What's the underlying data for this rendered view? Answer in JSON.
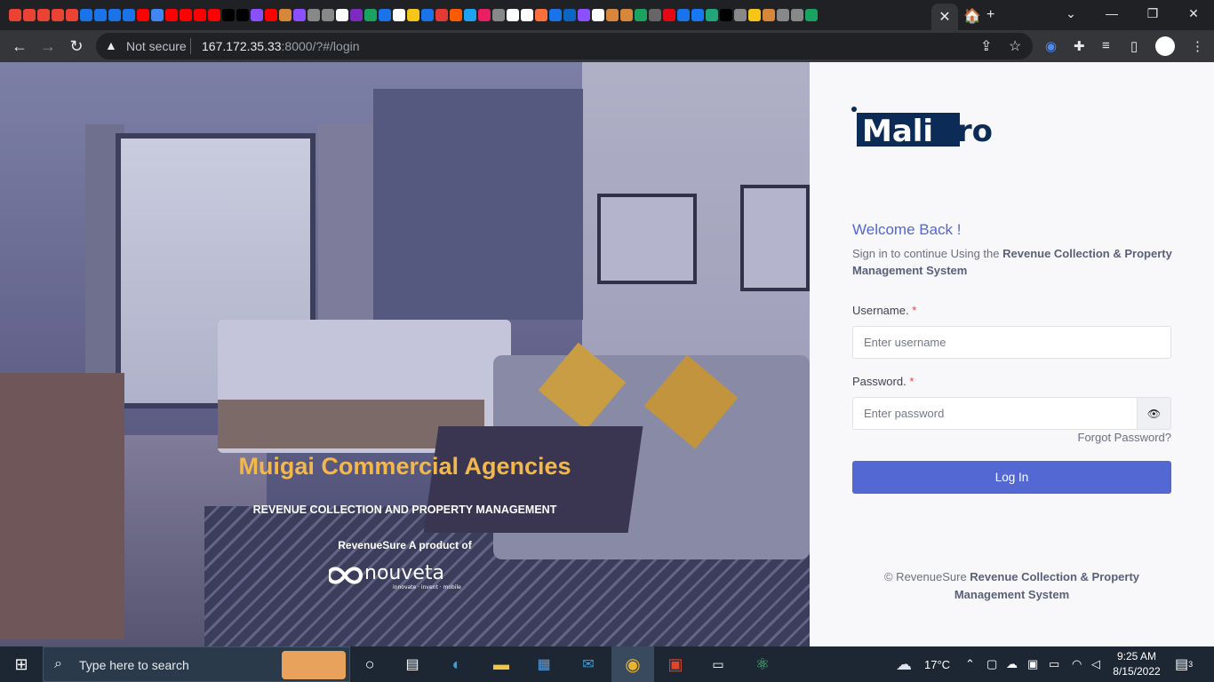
{
  "browser": {
    "active_tab_close": "✕",
    "new_tab": "+",
    "controls": {
      "dropdown": "⌄",
      "minimize": "—",
      "maximize": "❐",
      "close": "✕"
    },
    "security_label": "Not secure",
    "url_host": "167.172.35.33",
    "url_rest": ":8000/?#/login",
    "favicon_colors": [
      "#ea4335",
      "#ea4335",
      "#ea4335",
      "#ea4335",
      "#ea4335",
      "#1a73e8",
      "#1a73e8",
      "#1a73e8",
      "#1a73e8",
      "#ff0000",
      "#4285f4",
      "#ff0000",
      "#ff0000",
      "#ff0000",
      "#ff0000",
      "#000000",
      "#000000",
      "#8a4fff",
      "#ff0000",
      "#d6873a",
      "#8a4fff",
      "#888888",
      "#888888",
      "#ffffff",
      "#7b2cbf",
      "#1aa260",
      "#1a73e8",
      "#ffffff",
      "#f5c518",
      "#1a73e8",
      "#e53935",
      "#ff5a00",
      "#1da1f2",
      "#e91e63",
      "#888888",
      "#ffffff",
      "#ffffff",
      "#ff6f3c",
      "#1a73e8",
      "#0a66c2",
      "#8a4fff",
      "#ffffff",
      "#d6873a",
      "#d6873a",
      "#1aa260",
      "#666666",
      "#e50914",
      "#1a73e8",
      "#1877f2",
      "#21a67a",
      "#000000",
      "#888888",
      "#f5c518",
      "#d6873a",
      "#888888",
      "#888888",
      "#1aa260"
    ]
  },
  "hero": {
    "company": "Muigai Commercial Agencies",
    "tagline": "REVENUE COLLECTION AND PROPERTY MANAGEMENT",
    "product_line": "RevenueSure A product of",
    "logo_word": "nouveta",
    "logo_sub": "innovate · invent · mobile"
  },
  "login": {
    "logo_a": "Mali",
    "logo_b": "Pro",
    "welcome": "Welcome Back !",
    "intro": "Sign in to continue Using the ",
    "intro_bold": "Revenue Collection & Property Management System",
    "username_label": "Username.",
    "username_placeholder": "Enter username",
    "password_label": "Password.",
    "password_placeholder": "Enter password",
    "required_mark": "*",
    "eye": "👁",
    "forgot": "Forgot Password?",
    "login_button": "Log In",
    "footer_prefix": "© RevenueSure ",
    "footer_bold": "Revenue Collection & Property Management System"
  },
  "taskbar": {
    "search_placeholder": "Type here to search",
    "weather": "17°C",
    "time": "9:25 AM",
    "date": "8/15/2022",
    "notifications": "3"
  }
}
